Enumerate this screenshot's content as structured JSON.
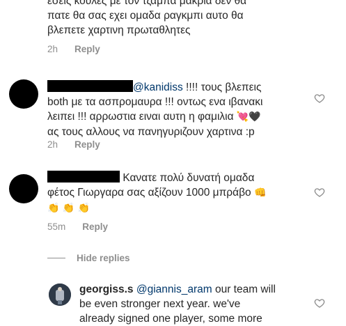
{
  "comment1": {
    "lines": [
      "εσεις κουλες με τον τζαμπα μακρια δεν θα",
      "πατε θα σας εχει ομαδα ραγκμπι αυτο θα",
      "βλεπετε χαρτινη πρωταθλητες"
    ],
    "time": "2h",
    "reply_label": "Reply"
  },
  "comment2": {
    "mention": "@kanidiss",
    "line1_rest": " !!!! τους βλεπεις",
    "line2": "both με τα ασπρομαυρα !!! οντως ενα ιβανακι",
    "line3_text": "λειπει !!! αρρωστια ειναι αυτη η φαμιλια",
    "line3_emoji1": "💘",
    "line3_emoji2": "🖤",
    "line4": "ας τους αλλους να πανηγυριζουν χαρτινα :p",
    "time": "2h",
    "reply_label": "Reply"
  },
  "comment3": {
    "line1": "Κανατε πολύ δυνατή ομαδα",
    "line2_text": "φέτος Γιωργαρα σας αξίζουν 1000 μπράβο",
    "line2_emoji": "👊",
    "line3_emoji": "👏 👏 👏",
    "time": "55m",
    "reply_label": "Reply"
  },
  "hide_replies_label": "Hide replies",
  "reply1": {
    "username": "georgiss.s",
    "mention": "@giannis_aram",
    "line1_rest": " our team will",
    "line2": "be even stronger next year. we've",
    "line3": "already signed one player, some more"
  },
  "icons": {
    "like": "heart-outline-icon",
    "emoji_heart_arrow": "heart-with-arrow",
    "emoji_black_heart": "black-heart",
    "emoji_fist": "oncoming-fist",
    "emoji_clap": "clapping-hands"
  }
}
